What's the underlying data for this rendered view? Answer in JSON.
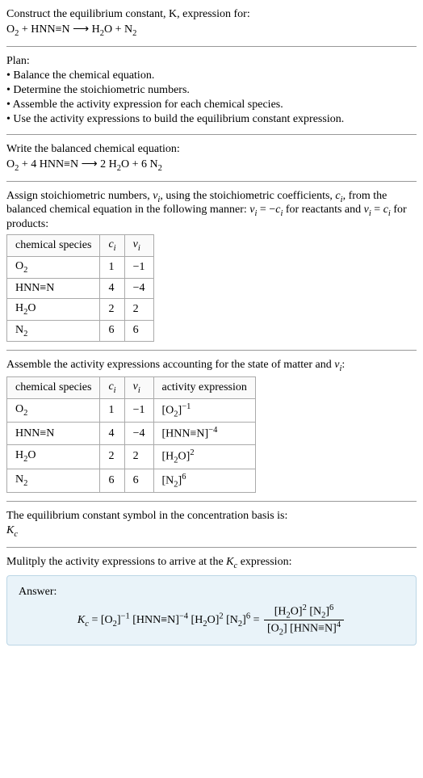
{
  "intro": {
    "l1": "Construct the equilibrium constant, K, expression for:",
    "l2_html": "O<sub>2</sub> + HNN≡N ⟶ H<sub>2</sub>O + N<sub>2</sub>"
  },
  "plan": {
    "heading": "Plan:",
    "b1": "• Balance the chemical equation.",
    "b2": "• Determine the stoichiometric numbers.",
    "b3": "• Assemble the activity expression for each chemical species.",
    "b4": "• Use the activity expressions to build the equilibrium constant expression."
  },
  "balanced": {
    "l1": "Write the balanced chemical equation:",
    "l2_html": "O<sub>2</sub> + 4 HNN≡N ⟶ 2 H<sub>2</sub>O + 6 N<sub>2</sub>"
  },
  "assign": {
    "text_html": "Assign stoichiometric numbers, <span class='italic'>ν<sub>i</sub></span>, using the stoichiometric coefficients, <span class='italic'>c<sub>i</sub></span>, from the balanced chemical equation in the following manner: <span class='italic'>ν<sub>i</sub></span> = −<span class='italic'>c<sub>i</sub></span> for reactants and <span class='italic'>ν<sub>i</sub></span> = <span class='italic'>c<sub>i</sub></span> for products:"
  },
  "table1": {
    "h1": "chemical species",
    "h2_html": "<span class='italic'>c<sub>i</sub></span>",
    "h3_html": "<span class='italic'>ν<sub>i</sub></span>",
    "rows": [
      {
        "sp_html": "O<sub>2</sub>",
        "c": "1",
        "v": "−1"
      },
      {
        "sp_html": "HNN≡N",
        "c": "4",
        "v": "−4"
      },
      {
        "sp_html": "H<sub>2</sub>O",
        "c": "2",
        "v": "2"
      },
      {
        "sp_html": "N<sub>2</sub>",
        "c": "6",
        "v": "6"
      }
    ]
  },
  "assemble": {
    "text_html": "Assemble the activity expressions accounting for the state of matter and <span class='italic'>ν<sub>i</sub></span>:"
  },
  "table2": {
    "h1": "chemical species",
    "h2_html": "<span class='italic'>c<sub>i</sub></span>",
    "h3_html": "<span class='italic'>ν<sub>i</sub></span>",
    "h4": "activity expression",
    "rows": [
      {
        "sp_html": "O<sub>2</sub>",
        "c": "1",
        "v": "−1",
        "a_html": "[O<sub>2</sub>]<sup>−1</sup>"
      },
      {
        "sp_html": "HNN≡N",
        "c": "4",
        "v": "−4",
        "a_html": "[HNN≡N]<sup>−4</sup>"
      },
      {
        "sp_html": "H<sub>2</sub>O",
        "c": "2",
        "v": "2",
        "a_html": "[H<sub>2</sub>O]<sup>2</sup>"
      },
      {
        "sp_html": "N<sub>2</sub>",
        "c": "6",
        "v": "6",
        "a_html": "[N<sub>2</sub>]<sup>6</sup>"
      }
    ]
  },
  "kc_symbol": {
    "l1": "The equilibrium constant symbol in the concentration basis is:",
    "l2_html": "<span class='italic'>K<sub>c</sub></span>"
  },
  "multiply": {
    "text_html": "Mulitply the activity expressions to arrive at the <span class='italic'>K<sub>c</sub></span> expression:"
  },
  "answer": {
    "label": "Answer:",
    "lhs_html": "<span class='italic'>K<sub>c</sub></span> = [O<sub>2</sub>]<sup>−1</sup> [HNN≡N]<sup>−4</sup> [H<sub>2</sub>O]<sup>2</sup> [N<sub>2</sub>]<sup>6</sup> = ",
    "num_html": "[H<sub>2</sub>O]<sup>2</sup> [N<sub>2</sub>]<sup>6</sup>",
    "den_html": "[O<sub>2</sub>] [HNN≡N]<sup>4</sup>"
  }
}
